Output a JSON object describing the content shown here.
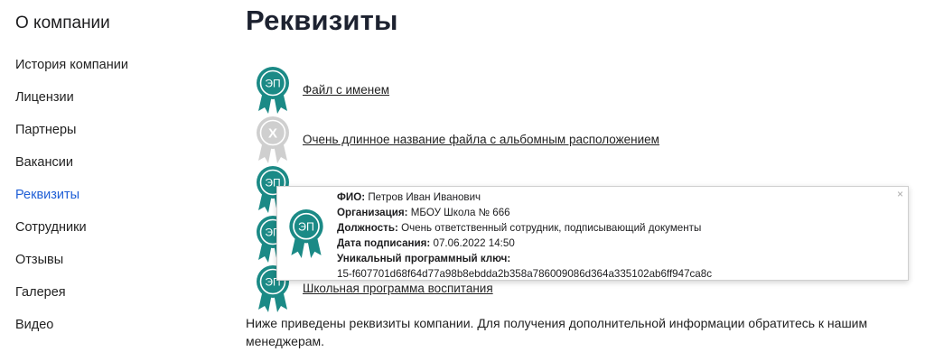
{
  "sidebar": {
    "title": "О компании",
    "items": [
      {
        "label": "История компании",
        "active": false
      },
      {
        "label": "Лицензии",
        "active": false
      },
      {
        "label": "Партнеры",
        "active": false
      },
      {
        "label": "Вакансии",
        "active": false
      },
      {
        "label": "Реквизиты",
        "active": true
      },
      {
        "label": "Сотрудники",
        "active": false
      },
      {
        "label": "Отзывы",
        "active": false
      },
      {
        "label": "Галерея",
        "active": false
      },
      {
        "label": "Видео",
        "active": false
      }
    ]
  },
  "main": {
    "title": "Реквизиты",
    "files": [
      {
        "name": "Файл с именем",
        "signature": "valid"
      },
      {
        "name": "Очень длинное название файла с альбомным расположением",
        "signature": "invalid"
      },
      {
        "name": "",
        "signature": "valid"
      },
      {
        "name": "",
        "signature": "valid"
      },
      {
        "name": "Школьная программа воспитания",
        "signature": "valid"
      }
    ],
    "badge_valid_text": "ЭП",
    "badge_invalid_text": "X",
    "note": "Ниже приведены реквизиты компании. Для получения дополнительной информации обратитесь к нашим менеджерам."
  },
  "signature_popup": {
    "badge_text": "ЭП",
    "close_symbol": "×",
    "fio_label": "ФИО:",
    "fio_value": "Петров Иван Иванович",
    "org_label": "Организация:",
    "org_value": "МБОУ Школа № 666",
    "position_label": "Должность:",
    "position_value": "Очень ответственный сотрудник, подписывающий документы",
    "date_label": "Дата подписания:",
    "date_value": "07.06.2022 14:50",
    "key_label": "Уникальный программный ключ:",
    "key_value": "15-f607701d68f64d77a98b8ebdda2b358a786009086d364a335102ab6ff947ca8c"
  },
  "colors": {
    "accent": "#1f5fd6",
    "badge_valid": "#1b8a86",
    "badge_invalid": "#cfcfcf"
  }
}
